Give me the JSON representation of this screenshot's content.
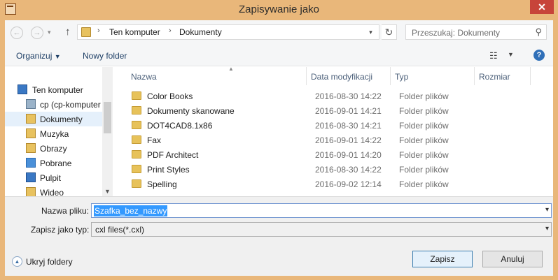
{
  "window": {
    "title": "Zapisywanie jako",
    "close_glyph": "✕"
  },
  "address": {
    "segments": [
      "Ten komputer",
      "Dokumenty"
    ],
    "search_placeholder": "Przeszukaj: Dokumenty"
  },
  "toolbar": {
    "organize": "Organizuj",
    "new_folder": "Nowy folder"
  },
  "nav": {
    "items": [
      {
        "label": "Ten komputer",
        "icon": "computer-icon"
      },
      {
        "label": "cp (cp-komputer",
        "icon": "network-drive-icon"
      },
      {
        "label": "Dokumenty",
        "icon": "documents-icon",
        "selected": true
      },
      {
        "label": "Muzyka",
        "icon": "music-icon"
      },
      {
        "label": "Obrazy",
        "icon": "pictures-icon"
      },
      {
        "label": "Pobrane",
        "icon": "downloads-icon"
      },
      {
        "label": "Pulpit",
        "icon": "desktop-icon"
      },
      {
        "label": "Wideo",
        "icon": "videos-icon"
      }
    ]
  },
  "columns": {
    "name": "Nazwa",
    "modified": "Data modyfikacji",
    "type": "Typ",
    "size": "Rozmiar"
  },
  "files": [
    {
      "name": "Color Books",
      "date": "2016-08-30 14:22",
      "type": "Folder plików"
    },
    {
      "name": "Dokumenty skanowane",
      "date": "2016-09-01 14:21",
      "type": "Folder plików"
    },
    {
      "name": "DOT4CAD8.1x86",
      "date": "2016-08-30 14:21",
      "type": "Folder plików"
    },
    {
      "name": "Fax",
      "date": "2016-09-01 14:22",
      "type": "Folder plików"
    },
    {
      "name": "PDF Architect",
      "date": "2016-09-01 14:20",
      "type": "Folder plików"
    },
    {
      "name": "Print Styles",
      "date": "2016-08-30 14:22",
      "type": "Folder plików"
    },
    {
      "name": "Spelling",
      "date": "2016-09-02 12:14",
      "type": "Folder plików"
    }
  ],
  "form": {
    "filename_label": "Nazwa pliku:",
    "filename_value": "Szafka_bez_nazwy",
    "filetype_label": "Zapisz jako typ:",
    "filetype_value": "cxl files(*.cxl)"
  },
  "footer": {
    "hide_folders": "Ukryj foldery",
    "save": "Zapisz",
    "cancel": "Anuluj"
  }
}
